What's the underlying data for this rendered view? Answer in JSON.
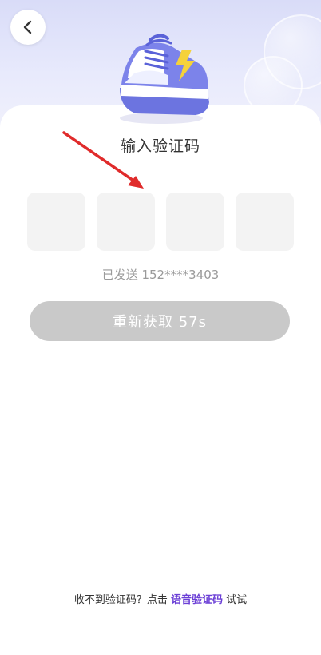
{
  "title": "输入验证码",
  "otp": {
    "boxes": [
      "",
      "",
      "",
      ""
    ]
  },
  "sent_text": "已发送 152****3403",
  "resend_label": "重新获取 57s",
  "footer": {
    "prefix": "收不到验证码？点击",
    "link": "语音验证码",
    "suffix": "试试"
  },
  "colors": {
    "accent": "#6b3fd6",
    "resend_bg": "#c9c9c9",
    "otp_bg": "#f3f3f3",
    "arrow": "#e02b2b"
  },
  "icons": {
    "back": "chevron-left-icon",
    "shoe": "sneaker-icon",
    "annotation": "red-arrow-icon"
  }
}
